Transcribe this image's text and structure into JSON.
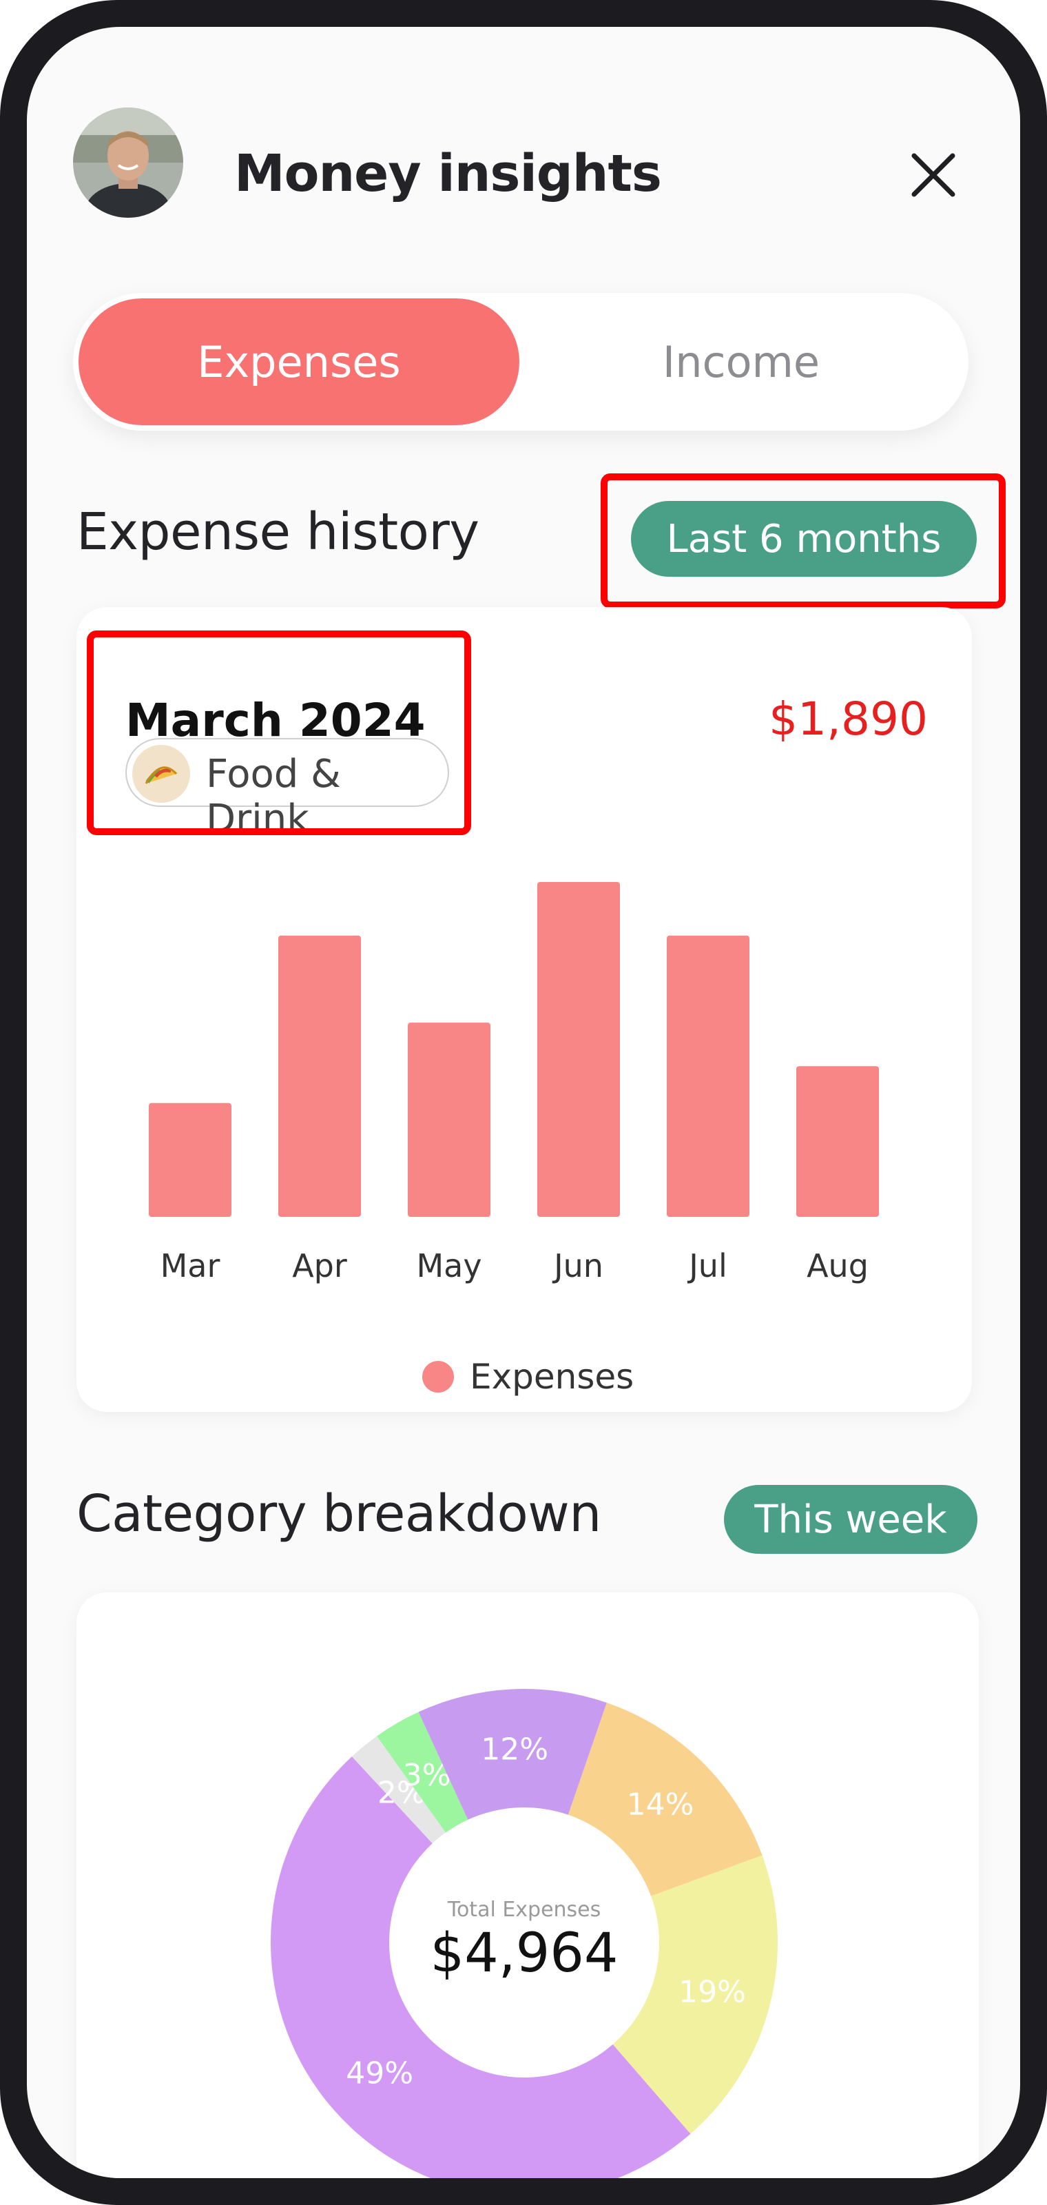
{
  "header": {
    "title": "Money insights"
  },
  "toggle": {
    "expenses": "Expenses",
    "income": "Income",
    "active": "Expenses"
  },
  "expense_history": {
    "title": "Expense history",
    "range_pill": "Last 6 months",
    "selected_month": "March 2024",
    "selected_amount": "$1,890",
    "category_chip": "Food & Drink",
    "legend": "Expenses"
  },
  "category_breakdown": {
    "title": "Category breakdown",
    "range_pill": "This week",
    "center_caption": "Total Expenses",
    "center_total": "$4,964"
  },
  "colors": {
    "accent": "#f87272",
    "bar": "#f98686",
    "pill": "#4aa087",
    "amount": "#e81f1f"
  },
  "chart_data": [
    {
      "type": "bar",
      "categories": [
        "Mar",
        "Apr",
        "May",
        "Jun",
        "Jul",
        "Aug"
      ],
      "series": [
        {
          "name": "Expenses",
          "values": [
            34,
            84,
            58,
            100,
            84,
            45
          ]
        }
      ],
      "legend": "bottom",
      "ylim": [
        0,
        100
      ],
      "grid": false,
      "note_scale": "relative bar heights, no y-axis shown"
    },
    {
      "type": "pie",
      "title": "",
      "center_label": "Total Expenses",
      "center_value": "$4,964",
      "slices": [
        {
          "label": "14%",
          "value": 14,
          "color": "#f9d28e"
        },
        {
          "label": "19%",
          "value": 19,
          "color": "#f1f1a0"
        },
        {
          "label": "49%",
          "value": 49,
          "color": "#d39af5"
        },
        {
          "label": "2%",
          "value": 2,
          "color": "#e6e6e6"
        },
        {
          "label": "3%",
          "value": 3,
          "color": "#9cf59f"
        },
        {
          "label": "12%",
          "value": 12,
          "color": "#c79cf0"
        }
      ]
    }
  ]
}
